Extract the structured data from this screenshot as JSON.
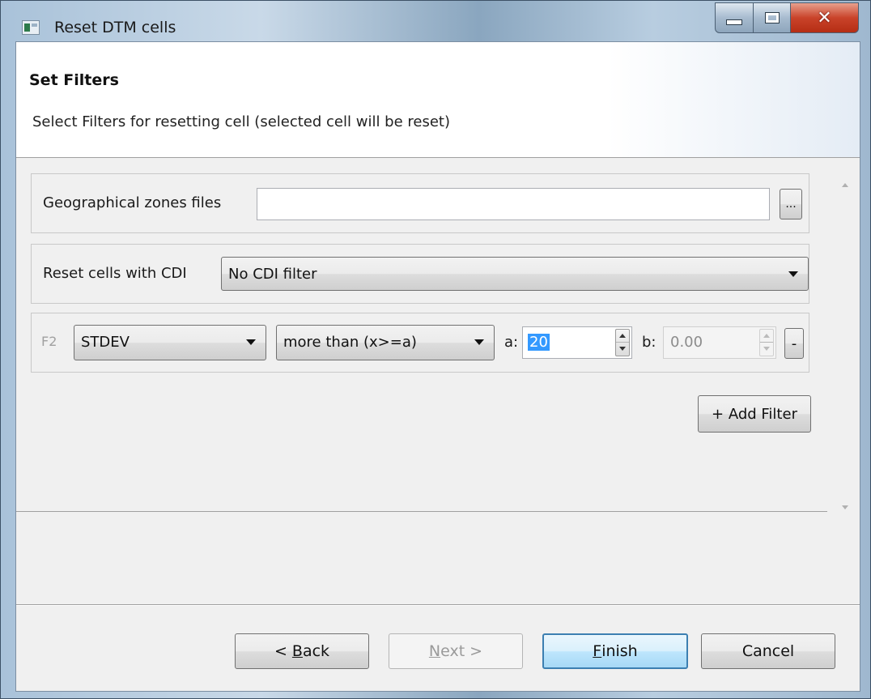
{
  "window": {
    "title": "Reset DTM cells",
    "controls": {
      "close_glyph": "✕"
    }
  },
  "header": {
    "title": "Set Filters",
    "description": "Select Filters for resetting cell (selected cell will be reset)"
  },
  "geo_zones": {
    "label": "Geographical zones files",
    "value": "",
    "browse_label": "..."
  },
  "cdi": {
    "label": "Reset cells with CDI",
    "selected": "No CDI filter"
  },
  "filter_row": {
    "id_label": "F2",
    "field_selected": "STDEV",
    "operator_selected": "more than (x>=a)",
    "a_label": "a:",
    "a_value": "20",
    "b_label": "b:",
    "b_value": "0.00",
    "remove_label": "-"
  },
  "add_filter_label": "+ Add Filter",
  "buttons": {
    "back": {
      "pre": "< ",
      "mnemonic": "B",
      "rest": "ack"
    },
    "next": {
      "mnemonic": "N",
      "rest": "ext >"
    },
    "finish": {
      "mnemonic": "F",
      "rest": "inish"
    },
    "cancel": "Cancel"
  },
  "colors": {
    "selection": "#3399ff",
    "default_button_border": "#3c7fb1",
    "close_button": "#c9432a"
  }
}
